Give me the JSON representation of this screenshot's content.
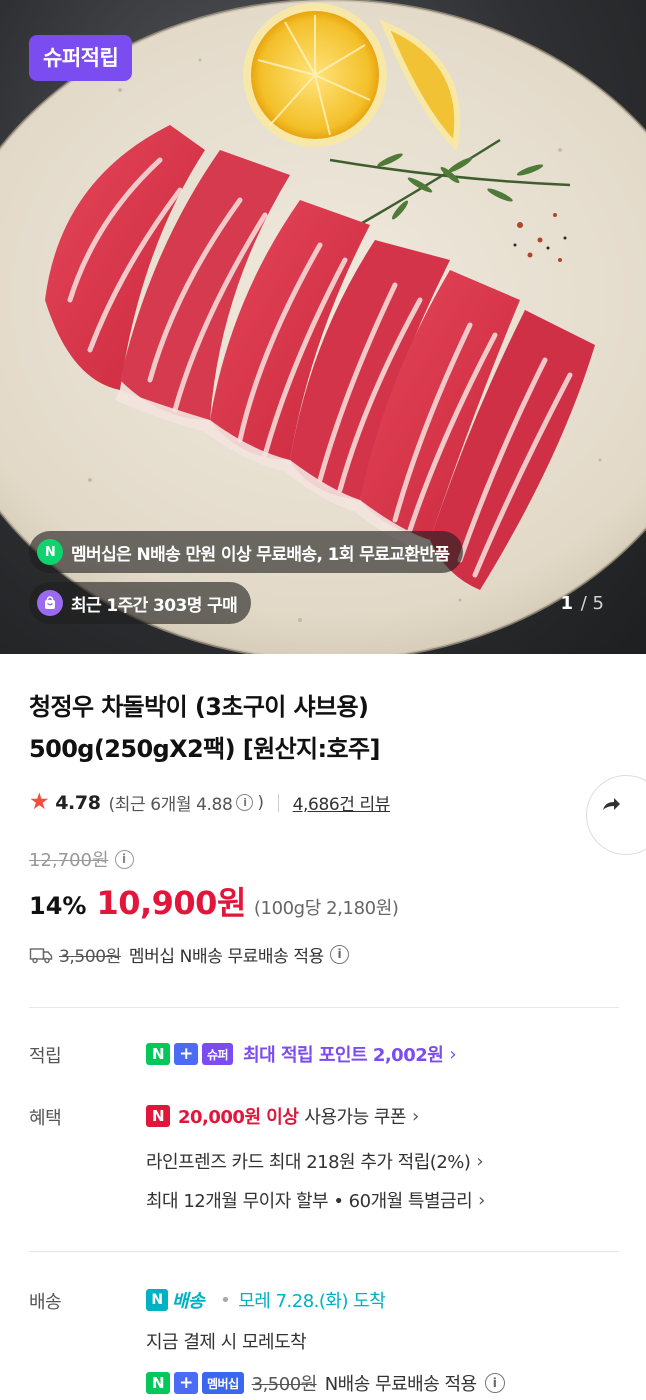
{
  "hero": {
    "badge": "슈퍼적립",
    "pill_membership": "멤버십은 N배송 만원 이상 무료배송, 1회 무료교환반품",
    "pill_membership_icon": "N",
    "pill_recent": "최근 1주간 303명 구매",
    "counter_current": "1",
    "counter_separator": "/",
    "counter_total": "5"
  },
  "product": {
    "title_line1": "청정우 차돌박이 (3초구이 샤브용)",
    "title_line2": "500g(250gX2팩) [원산지:호주]"
  },
  "rating": {
    "star": "★",
    "score": "4.78",
    "recent_prefix": "(최근 6개월 4.88",
    "info": "i",
    "recent_suffix": ")",
    "reviews": "4,686건 리뷰"
  },
  "price": {
    "original": "12,700원",
    "info": "i",
    "discount": "14%",
    "sale": "10,900원",
    "unit_price": "(100g당 2,180원)"
  },
  "shipping_note": {
    "old_fee": "3,500원",
    "text": "멤버십 N배송 무료배송 적용",
    "info": "i"
  },
  "benefits": {
    "points_label": "적립",
    "points_tag_n": "N",
    "points_tag_plus": "+",
    "points_tag_super": "슈퍼",
    "points_text": "최대 적립 포인트 2,002원",
    "perks_label": "혜택",
    "coupon_tag": "N",
    "coupon_highlight": "20,000원 이상",
    "coupon_text": "사용가능 쿠폰",
    "card_text": "라인프렌즈 카드 최대 218원 추가 적립(2%)",
    "installment_text": "최대 12개월 무이자 할부 • 60개월 특별금리",
    "chevron": "›"
  },
  "delivery": {
    "label": "배송",
    "n_icon": "N",
    "n_label": "배송",
    "dot": "•",
    "arrival": "모레 7.28.(화) 도착",
    "pay_note": "지금 결제 시 모레도착",
    "tag_n": "N",
    "tag_plus": "+",
    "tag_member": "멤버십",
    "old_fee": "3,500원",
    "fee_text": "N배송 무료배송 적용",
    "info": "i"
  },
  "colors": {
    "accent_purple": "#7b4cf0",
    "price_red": "#e2153a",
    "naver_green": "#03c75a",
    "delivery_teal": "#00b1c3"
  }
}
